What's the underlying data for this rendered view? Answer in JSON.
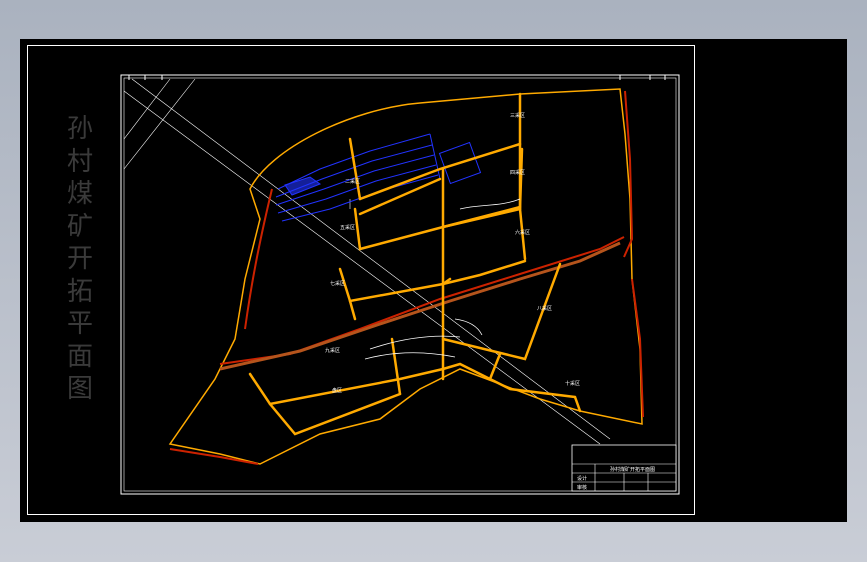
{
  "title_chars": [
    "孙",
    "村",
    "煤",
    "矿",
    "开",
    "拓",
    "平",
    "面",
    "图"
  ],
  "zone_labels": [
    "盘区",
    "二采区",
    "三采区",
    "四采区",
    "五采区",
    "六采区",
    "七采区",
    "八采区",
    "九采区",
    "十采区"
  ],
  "title_block": {
    "heading": "孙村煤矿开拓平面图",
    "rows": [
      "设计",
      "审核"
    ]
  },
  "colors": {
    "background": "#000000",
    "frame": "#ffffff",
    "roadway": "#ffaa00",
    "boundary_red": "#cc2200",
    "workings": "#2233ff"
  }
}
